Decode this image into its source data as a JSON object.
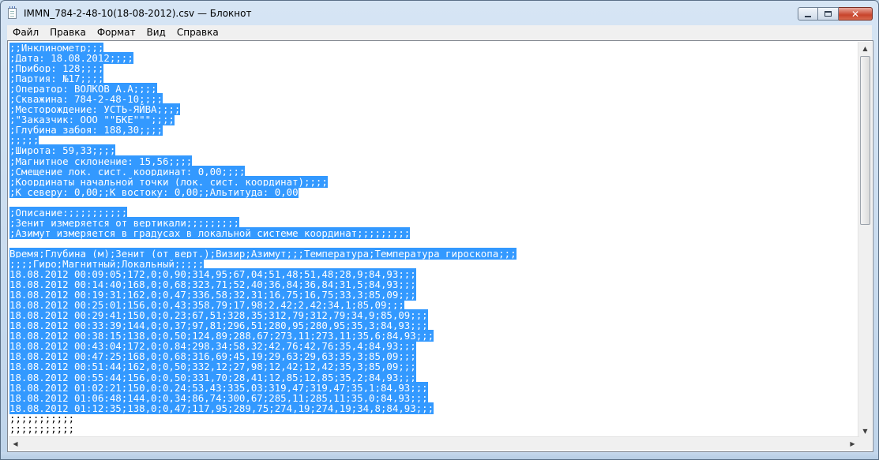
{
  "window": {
    "title": "IMMN_784-2-48-10(18-08-2012).csv — Блокнот",
    "accent": "#3399ff"
  },
  "menu": [
    "Файл",
    "Правка",
    "Формат",
    "Вид",
    "Справка"
  ],
  "content": {
    "lines": [
      {
        "text": ";;Инклинометр;;;",
        "selected": true
      },
      {
        "text": ";Дата: 18.08.2012;;;;",
        "selected": true
      },
      {
        "text": ";Прибор: 128;;;;",
        "selected": true
      },
      {
        "text": ";Партия: №17;;;;",
        "selected": true
      },
      {
        "text": ";Оператор: ВОЛКОВ А.А;;;;",
        "selected": true
      },
      {
        "text": ";Скважина: 784-2-48-10;;;;",
        "selected": true
      },
      {
        "text": ";Месторождение: УСТЬ-ЯЙВА;;;;",
        "selected": true
      },
      {
        "text": ";\"Заказчик: ООО \"\"БКЕ\"\"\";;;;",
        "selected": true
      },
      {
        "text": ";Глубина забоя: 188,30;;;;",
        "selected": true
      },
      {
        "text": ";;;;;",
        "selected": true
      },
      {
        "text": ";Широта: 59,33;;;;",
        "selected": true
      },
      {
        "text": ";Магнитное склонение: 15,56;;;;",
        "selected": true
      },
      {
        "text": ";Смещение лок. сист. координат: 0,00;;;;",
        "selected": true
      },
      {
        "text": ";Координаты начальной точки (лок. сист. координат);;;;",
        "selected": true
      },
      {
        "text": ";К северу: 0,00;;К востоку: 0,00;;Альтитуда: 0,00",
        "selected": true
      },
      {
        "text": "",
        "selected": false
      },
      {
        "text": ";Описание:;;;;;;;;;;",
        "selected": true
      },
      {
        "text": ";Зенит измеряется от вертикали;;;;;;;;;",
        "selected": true
      },
      {
        "text": ";Азимут измеряется в градусах в локальной системе координат;;;;;;;;;",
        "selected": true
      },
      {
        "text": "",
        "selected": false
      },
      {
        "text": "Время;Глубина (м);Зенит (от верт.);Визир;Азимут;;;Температура;Температура гироскопа;;;",
        "selected": true
      },
      {
        "text": ";;;;Гиро;Магнитный;Локальный;;;;;",
        "selected": true
      },
      {
        "text": "18.08.2012 00:09:05;172,0;0,90;314,95;67,04;51,48;51,48;28,9;84,93;;;",
        "selected": true
      },
      {
        "text": "18.08.2012 00:14:40;168,0;0,68;323,71;52,40;36,84;36,84;31,5;84,93;;;",
        "selected": true
      },
      {
        "text": "18.08.2012 00:19:31;162,0;0,47;336,58;32,31;16,75;16,75;33,3;85,09;;;",
        "selected": true
      },
      {
        "text": "18.08.2012 00:25:01;156,0;0,43;358,79;17,98;2,42;2,42;34,1;85,09;;;",
        "selected": true
      },
      {
        "text": "18.08.2012 00:29:41;150,0;0,23;67,51;328,35;312,79;312,79;34,9;85,09;;;",
        "selected": true
      },
      {
        "text": "18.08.2012 00:33:39;144,0;0,37;97,81;296,51;280,95;280,95;35,3;84,93;;;",
        "selected": true
      },
      {
        "text": "18.08.2012 00:38:15;138,0;0,50;124,89;288,67;273,11;273,11;35,6;84,93;;;",
        "selected": true
      },
      {
        "text": "18.08.2012 00:43:04;172,0;0,84;298,34;58,32;42,76;42,76;35,4;84,93;;;",
        "selected": true
      },
      {
        "text": "18.08.2012 00:47:25;168,0;0,68;316,69;45,19;29,63;29,63;35,3;85,09;;;",
        "selected": true
      },
      {
        "text": "18.08.2012 00:51:44;162,0;0,50;332,12;27,98;12,42;12,42;35,3;85,09;;;",
        "selected": true
      },
      {
        "text": "18.08.2012 00:55:44;156,0;0,50;331,70;28,41;12,85;12,85;35,2;84,93;;;",
        "selected": true
      },
      {
        "text": "18.08.2012 01:02:21;150,0;0,24;53,43;335,03;319,47;319,47;35,1;84,93;;;",
        "selected": true
      },
      {
        "text": "18.08.2012 01:06:48;144,0;0,34;86,74;300,67;285,11;285,11;35,0;84,93;;;",
        "selected": true
      },
      {
        "text": "18.08.2012 01:12:35;138,0;0,47;117,95;289,75;274,19;274,19;34,8;84,93;;;",
        "selected": true
      },
      {
        "text": ";;;;;;;;;;;",
        "selected": false
      },
      {
        "text": ";;;;;;;;;;;",
        "selected": false
      }
    ]
  }
}
